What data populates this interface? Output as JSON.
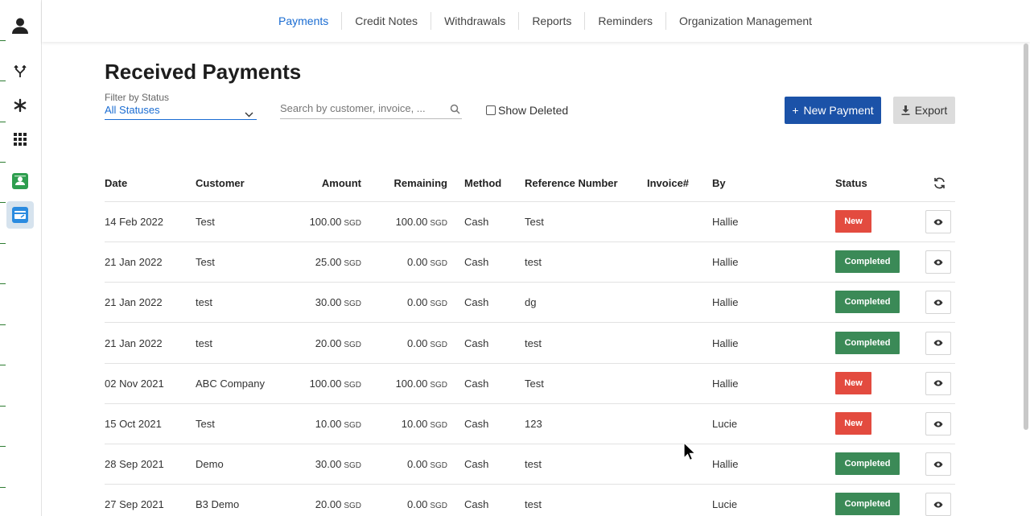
{
  "nav": {
    "tabs": [
      {
        "label": "Payments",
        "active": true
      },
      {
        "label": "Credit Notes"
      },
      {
        "label": "Withdrawals"
      },
      {
        "label": "Reports"
      },
      {
        "label": "Reminders"
      },
      {
        "label": "Organization Management"
      }
    ]
  },
  "page": {
    "title": "Received Payments"
  },
  "filter": {
    "label": "Filter by Status",
    "value": "All Statuses"
  },
  "search": {
    "placeholder": "Search by customer, invoice, ..."
  },
  "show_deleted": {
    "label": "Show Deleted",
    "checked": false
  },
  "actions": {
    "new_payment": "New Payment",
    "export": "Export"
  },
  "table": {
    "headers": {
      "date": "Date",
      "customer": "Customer",
      "amount": "Amount",
      "remaining": "Remaining",
      "method": "Method",
      "reference": "Reference Number",
      "invoice": "Invoice#",
      "by": "By",
      "status": "Status"
    },
    "rows": [
      {
        "date": "14 Feb 2022",
        "customer": "Test",
        "amount": "100.00",
        "amount_cur": "SGD",
        "remaining": "100.00",
        "remaining_cur": "SGD",
        "method": "Cash",
        "reference": "Test",
        "invoice": "",
        "by": "Hallie",
        "status": "New"
      },
      {
        "date": "21 Jan 2022",
        "customer": "Test",
        "amount": "25.00",
        "amount_cur": "SGD",
        "remaining": "0.00",
        "remaining_cur": "SGD",
        "method": "Cash",
        "reference": "test",
        "invoice": "",
        "by": "Hallie",
        "status": "Completed"
      },
      {
        "date": "21 Jan 2022",
        "customer": "test",
        "amount": "30.00",
        "amount_cur": "SGD",
        "remaining": "0.00",
        "remaining_cur": "SGD",
        "method": "Cash",
        "reference": "dg",
        "invoice": "",
        "by": "Hallie",
        "status": "Completed"
      },
      {
        "date": "21 Jan 2022",
        "customer": "test",
        "amount": "20.00",
        "amount_cur": "SGD",
        "remaining": "0.00",
        "remaining_cur": "SGD",
        "method": "Cash",
        "reference": "test",
        "invoice": "",
        "by": "Hallie",
        "status": "Completed"
      },
      {
        "date": "02 Nov 2021",
        "customer": "ABC Company",
        "amount": "100.00",
        "amount_cur": "SGD",
        "remaining": "100.00",
        "remaining_cur": "SGD",
        "method": "Cash",
        "reference": "Test",
        "invoice": "",
        "by": "Hallie",
        "status": "New"
      },
      {
        "date": "15 Oct 2021",
        "customer": "Test",
        "amount": "10.00",
        "amount_cur": "SGD",
        "remaining": "10.00",
        "remaining_cur": "SGD",
        "method": "Cash",
        "reference": "123",
        "invoice": "",
        "by": "Lucie",
        "status": "New"
      },
      {
        "date": "28 Sep 2021",
        "customer": "Demo",
        "amount": "30.00",
        "amount_cur": "SGD",
        "remaining": "0.00",
        "remaining_cur": "SGD",
        "method": "Cash",
        "reference": "test",
        "invoice": "",
        "by": "Hallie",
        "status": "Completed"
      },
      {
        "date": "27 Sep 2021",
        "customer": "B3 Demo",
        "amount": "20.00",
        "amount_cur": "SGD",
        "remaining": "0.00",
        "remaining_cur": "SGD",
        "method": "Cash",
        "reference": "test",
        "invoice": "",
        "by": "Lucie",
        "status": "Completed"
      }
    ]
  },
  "colors": {
    "accent": "#1a6cd2",
    "primary_button": "#1b52a8",
    "status_new": "#e34b3f",
    "status_completed": "#3b8a57"
  },
  "icons": {
    "rail": [
      "user-icon",
      "branch-icon",
      "asterisk-icon",
      "apps-grid-icon",
      "contacts-app-icon",
      "payments-app-icon"
    ],
    "row_action": "eye-icon",
    "refresh": "refresh-icon"
  }
}
